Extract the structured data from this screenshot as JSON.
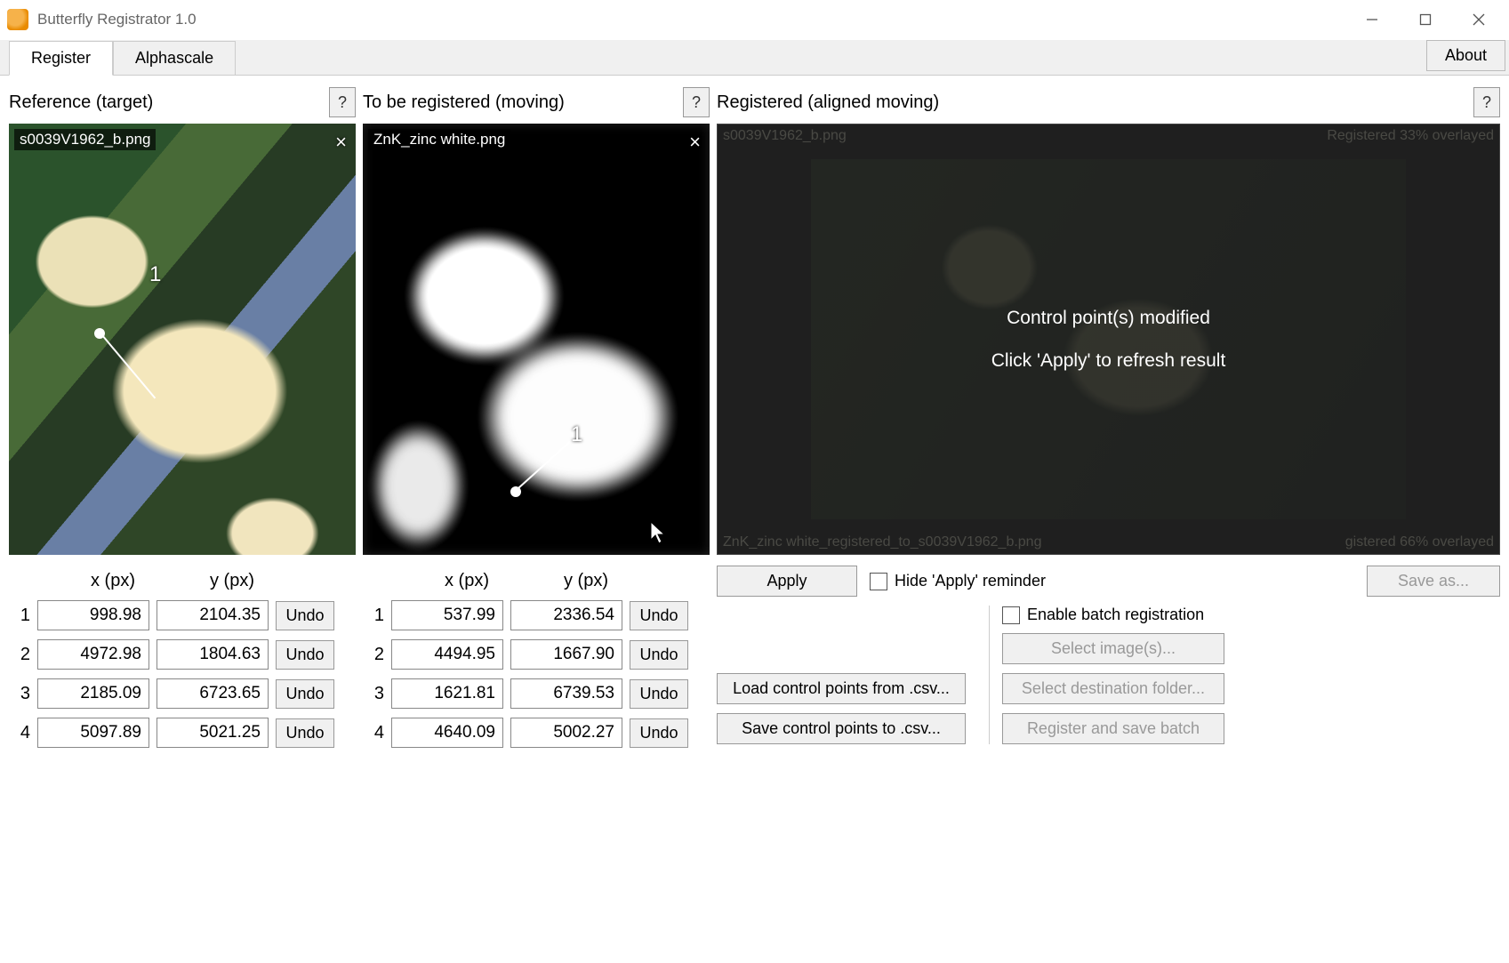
{
  "window": {
    "title": "Butterfly Registrator 1.0"
  },
  "tabs": {
    "register": "Register",
    "alphascale": "Alphascale",
    "about": "About"
  },
  "panels": {
    "reference": {
      "title": "Reference (target)",
      "help": "?",
      "filename": "s0039V1962_b.png"
    },
    "moving": {
      "title": "To be registered (moving)",
      "help": "?",
      "filename": "ZnK_zinc white.png"
    },
    "result": {
      "title": "Registered (aligned moving)",
      "help": "?"
    }
  },
  "result_overlay": {
    "top_left": "s0039V1962_b.png",
    "top_right": "Registered 33% overlayed",
    "bottom_left": "ZnK_zinc white_registered_to_s0039V1962_b.png",
    "bottom_right": "gistered 66% overlayed",
    "msg1": "Control point(s) modified",
    "msg2": "Click 'Apply' to refresh result"
  },
  "columns": {
    "x": "x (px)",
    "y": "y (px)"
  },
  "ref_points": [
    {
      "i": "1",
      "x": "998.98",
      "y": "2104.35"
    },
    {
      "i": "2",
      "x": "4972.98",
      "y": "1804.63"
    },
    {
      "i": "3",
      "x": "2185.09",
      "y": "6723.65"
    },
    {
      "i": "4",
      "x": "5097.89",
      "y": "5021.25"
    }
  ],
  "mov_points": [
    {
      "i": "1",
      "x": "537.99",
      "y": "2336.54"
    },
    {
      "i": "2",
      "x": "4494.95",
      "y": "1667.90"
    },
    {
      "i": "3",
      "x": "1621.81",
      "y": "6739.53"
    },
    {
      "i": "4",
      "x": "4640.09",
      "y": "5002.27"
    }
  ],
  "buttons": {
    "undo": "Undo",
    "apply": "Apply",
    "hide_reminder": "Hide 'Apply' reminder",
    "save_as": "Save as...",
    "load_csv": "Load control points from .csv...",
    "save_csv": "Save control points to .csv...",
    "enable_batch": "Enable batch registration",
    "select_images": "Select image(s)...",
    "select_dest": "Select destination folder...",
    "run_batch": "Register and save batch"
  }
}
